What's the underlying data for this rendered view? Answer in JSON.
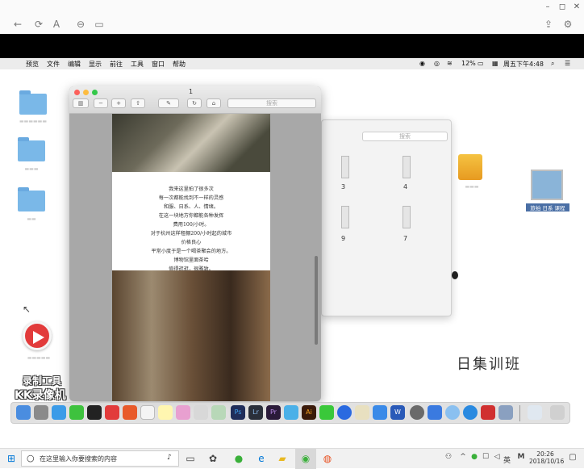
{
  "window_controls": {
    "minimize": "–",
    "maximize": "◻",
    "close": "✕"
  },
  "toolbar": {
    "back": "←",
    "refresh": "⟳",
    "text_a": "A"
  },
  "mac_menubar": {
    "apple": "",
    "items": [
      "预览",
      "文件",
      "编辑",
      "显示",
      "前往",
      "工具",
      "窗口",
      "帮助"
    ],
    "battery": "12%",
    "clock": "周五下午4:48"
  },
  "preview": {
    "title": "1",
    "search_placeholder": "搜索",
    "page_text": [
      "我来这里拍了很多次",
      "每一次都能找到不一样的灵感",
      "和服、日系、人、情绪。",
      "在这一块地方你都能各种发挥",
      "费用100/小时。",
      "对于杭州这样租棚200/小时起的城市",
      "价格良心",
      "平常小度于是一个喝茶聚会的地方。",
      "博物馆里面茶哈",
      "值得逛逛，很雅致。"
    ]
  },
  "finder": {
    "search_placeholder": "搜索",
    "thumbnails": [
      "3",
      "4",
      "9",
      "7"
    ]
  },
  "desktop_right_label": "日集训班",
  "folder_label": "旅拍 日系 课程",
  "watermark": {
    "line1": "录制工具",
    "line2": "KK录像机"
  },
  "taskbar": {
    "search_placeholder": "在这里输入你要搜索的内容",
    "ime": "英",
    "time": "20:26",
    "date": "2018/10/16"
  },
  "colors": {
    "accent": "#0078d7",
    "folder": "#7ab8e8"
  }
}
